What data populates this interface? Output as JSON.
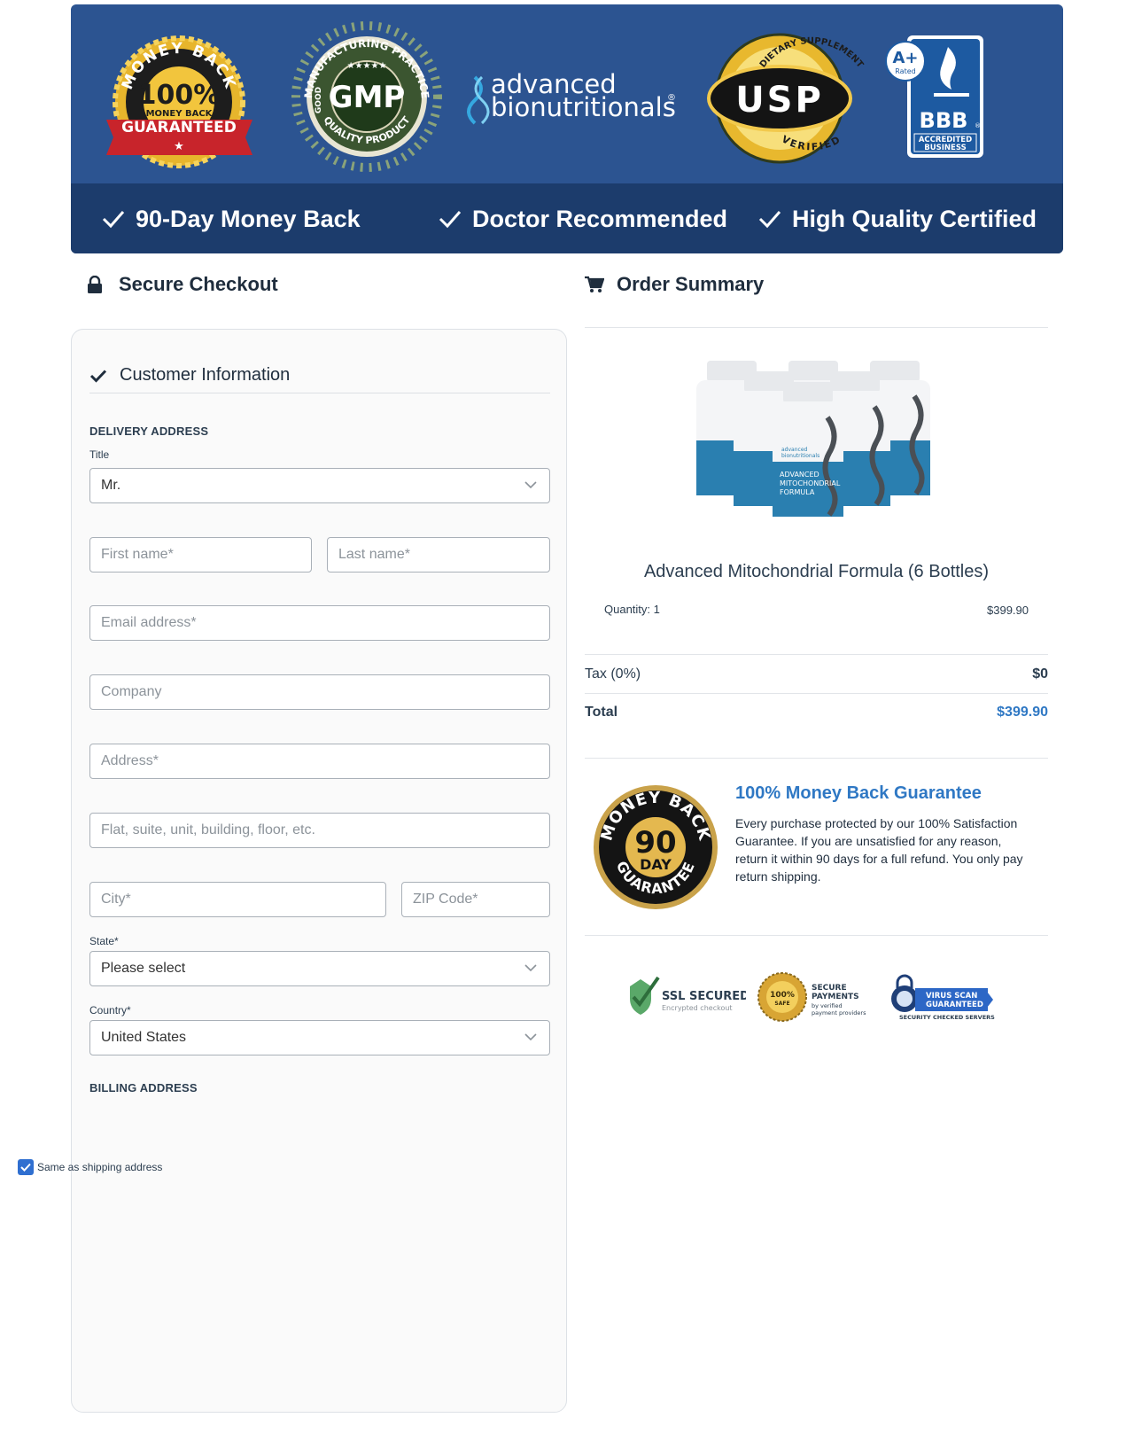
{
  "header": {
    "badges": {
      "moneyback": {
        "ring": "MONEY BACK",
        "big": "100%",
        "small": "MONEY BACK",
        "ribbon": "GUARANTEED"
      },
      "gmp": {
        "top": "MANUFACTURING PRACTICE",
        "left": "GOOD",
        "center": "GMP",
        "bottom": "QUALITY PRODUCT"
      },
      "brand": {
        "line1": "advanced",
        "line2": "bionutritionals",
        "mark": "®"
      },
      "usp": {
        "top": "DIETARY SUPPLEMENT",
        "center": "USP",
        "bottom": "VERIFIED"
      },
      "bbb": {
        "rating": "A+",
        "rated": "Rated",
        "name": "BBB",
        "mark": "®",
        "line1": "ACCREDITED",
        "line2": "BUSINESS"
      }
    },
    "bar": [
      {
        "label": "90-Day Money Back"
      },
      {
        "label": "Doctor Recommended"
      },
      {
        "label": "High Quality Certified"
      }
    ]
  },
  "checkout": {
    "title": "Secure Checkout",
    "customer_info": "Customer Information",
    "delivery_heading": "DELIVERY ADDRESS",
    "title_label": "Title",
    "title_value": "Mr.",
    "first_name_placeholder": "First name*",
    "last_name_placeholder": "Last name*",
    "email_placeholder": "Email address*",
    "company_placeholder": "Company",
    "address_placeholder": "Address*",
    "address2_placeholder": "Flat, suite, unit, building, floor, etc.",
    "city_placeholder": "City*",
    "zip_placeholder": "ZIP Code*",
    "state_label": "State*",
    "state_value": "Please select",
    "country_label": "Country*",
    "country_value": "United States",
    "billing_heading": "BILLING ADDRESS",
    "same_as_shipping": "Same as shipping address",
    "same_as_shipping_checked": true
  },
  "summary": {
    "title": "Order Summary",
    "bottle_label": {
      "brand1": "advanced",
      "brand2": "bionutritionals",
      "line1": "ADVANCED",
      "line2": "MITOCHONDRIAL",
      "line3": "FORMULA"
    },
    "product_name": "Advanced Mitochondrial Formula (6 Bottles)",
    "quantity_text": "Quantity: 1",
    "line_price": "$399.90",
    "tax_label": "Tax (0%)",
    "tax_value": "$0",
    "total_label": "Total",
    "total_value": "$399.90",
    "guarantee": {
      "seal_top": "MONEY BACK",
      "seal_num": "90",
      "seal_day": "DAY",
      "seal_bottom": "GUARANTEE",
      "title": "100% Money Back Guarantee",
      "text": "Every purchase protected by our 100% Satisfaction Guarantee. If you are unsatisfied for any reason, return it within 90 days for a full refund. You only pay return shipping."
    },
    "trust_badges": {
      "ssl_title": "SSL SECURED",
      "ssl_sub": "Encrypted checkout",
      "pay_seal_line1": "100%",
      "pay_seal_line2": "SAFE",
      "pay_title1": "SECURE",
      "pay_title2": "PAYMENTS",
      "pay_sub1": "by verified",
      "pay_sub2": "payment providers",
      "virus_line1": "VIRUS SCAN",
      "virus_line2": "GUARANTEED",
      "virus_sub": "SECURITY CHECKED SERVERS"
    }
  },
  "colors": {
    "banner_blue": "#2c5491",
    "banner_dark": "#1c3c6c",
    "accent_blue": "#2f78c4",
    "checkbox_blue": "#2f6fd0"
  }
}
